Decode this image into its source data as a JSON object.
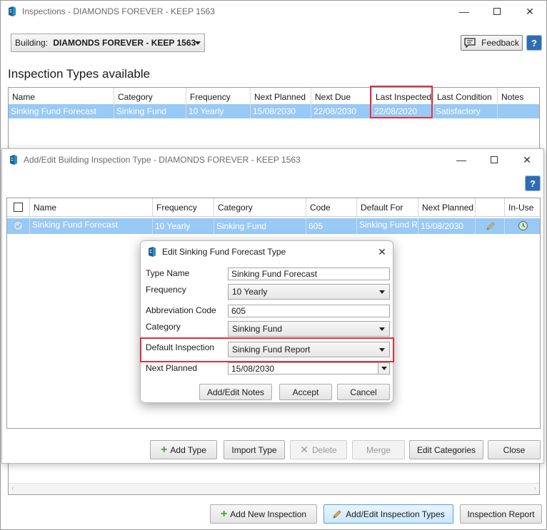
{
  "main_window": {
    "title": "Inspections - DIAMONDS FOREVER - KEEP 1563",
    "building_label": "Building:",
    "building_value": "DIAMONDS FOREVER - KEEP  1563",
    "feedback_label": "Feedback",
    "help_label": "?",
    "section_title": "Inspection Types available",
    "columns": [
      "Name",
      "Category",
      "Frequency",
      "Next Planned",
      "Next Due",
      "Last Inspected",
      "Last Condition",
      "Notes"
    ],
    "rows": [
      [
        "Sinking Fund Forecast",
        "Sinking Fund",
        "10 Yearly",
        "15/08/2030",
        "22/08/2030",
        "22/08/2020",
        "Satisfactory",
        ""
      ]
    ],
    "buttons": {
      "add_new_inspection": "Add New Inspection",
      "add_edit_inspection_types": "Add/Edit Inspection Types",
      "inspection_report": "Inspection Report"
    }
  },
  "edit_window": {
    "title": "Add/Edit Building Inspection Type - DIAMONDS FOREVER - KEEP 1563",
    "help_label": "?",
    "columns": [
      "Name",
      "Frequency",
      "Category",
      "Code",
      "Default For",
      "Next Planned",
      "",
      "In-Use"
    ],
    "rows": [
      [
        "Sinking Fund Forecast",
        "10 Yearly",
        "Sinking Fund",
        "605",
        "Sinking Fund Re",
        "15/08/2030"
      ]
    ],
    "buttons": {
      "add_type": "Add Type",
      "import_type": "Import Type",
      "delete": "Delete",
      "merge": "Merge",
      "edit_categories": "Edit Categories",
      "close": "Close"
    }
  },
  "dialog": {
    "title": "Edit Sinking Fund Forecast Type",
    "fields": {
      "type_name_label": "Type Name",
      "type_name_value": "Sinking Fund Forecast",
      "frequency_label": "Frequency",
      "frequency_value": "10 Yearly",
      "abbreviation_label": "Abbreviation Code",
      "abbreviation_value": "605",
      "category_label": "Category",
      "category_value": "Sinking Fund",
      "default_inspection_label": "Default Inspection",
      "default_inspection_value": "Sinking Fund Report",
      "next_planned_label": "Next Planned",
      "next_planned_value": "15/08/2030"
    },
    "buttons": {
      "add_edit_notes": "Add/Edit Notes",
      "accept": "Accept",
      "cancel": "Cancel"
    }
  },
  "colors": {
    "selection": "#99c9f5",
    "highlight_box": "#e0303a",
    "accent": "#2e6db3"
  },
  "icons": [
    "app-icon",
    "minimize-icon",
    "maximize-icon",
    "close-icon",
    "feedback-icon",
    "help-icon",
    "plus-icon",
    "pencil-icon",
    "x-icon",
    "checkbox-icon",
    "check-circle-icon",
    "clock-icon",
    "chevron-down-icon"
  ]
}
